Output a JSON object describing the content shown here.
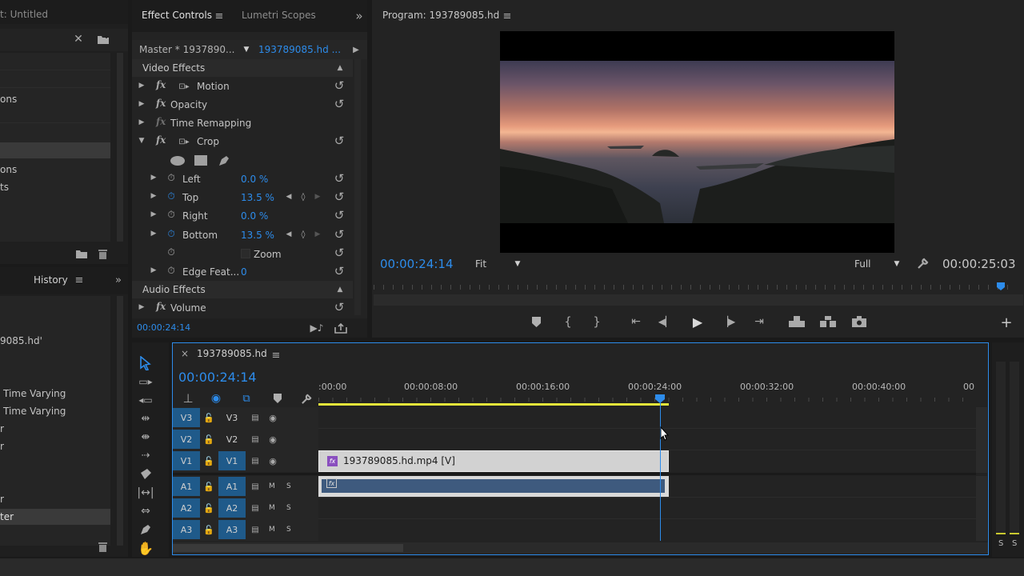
{
  "project": {
    "title": "t: Untitled",
    "items": [
      "ons",
      "ons",
      "ts"
    ]
  },
  "effect_controls": {
    "tab_active": "Effect Controls",
    "tab_other": "Lumetri Scopes",
    "master_label": "Master * 1937890...",
    "clip_label": "193789085.hd ...",
    "video_effects_label": "Video Effects",
    "audio_effects_label": "Audio Effects",
    "fx_motion": "Motion",
    "fx_opacity": "Opacity",
    "fx_time_remap": "Time Remapping",
    "fx_crop": "Crop",
    "crop_left_label": "Left",
    "crop_left_value": "0.0 %",
    "crop_top_label": "Top",
    "crop_top_value": "13.5 %",
    "crop_right_label": "Right",
    "crop_right_value": "0.0 %",
    "crop_bottom_label": "Bottom",
    "crop_bottom_value": "13.5 %",
    "zoom_label": "Zoom",
    "edge_label": "Edge Feat...",
    "edge_value": "0",
    "fx_volume": "Volume",
    "timecode": "00:00:24:14"
  },
  "history": {
    "title": "History",
    "items": [
      "9085.hd'",
      "Time Varying",
      "Time Varying",
      "r",
      "r",
      "r",
      "ter"
    ]
  },
  "program": {
    "title": "Program: 193789085.hd",
    "timecode": "00:00:24:14",
    "fit_label": "Fit",
    "quality_label": "Full",
    "duration": "00:00:25:03"
  },
  "timeline": {
    "sequence_name": "193789085.hd",
    "timecode": "00:00:24:14",
    "ruler_labels": [
      ":00:00",
      "00:00:08:00",
      "00:00:16:00",
      "00:00:24:00",
      "00:00:32:00",
      "00:00:40:00",
      "00"
    ],
    "tracks": {
      "v3": "V3",
      "v2": "V2",
      "v1": "V1",
      "a1": "A1",
      "a2": "A2",
      "a3": "A3"
    },
    "video_clip": "193789085.hd.mp4 [V]",
    "fx_badge": "fx",
    "mute_label": "M",
    "solo_label": "S"
  },
  "meter": {
    "left_label": "S",
    "right_label": "S"
  }
}
